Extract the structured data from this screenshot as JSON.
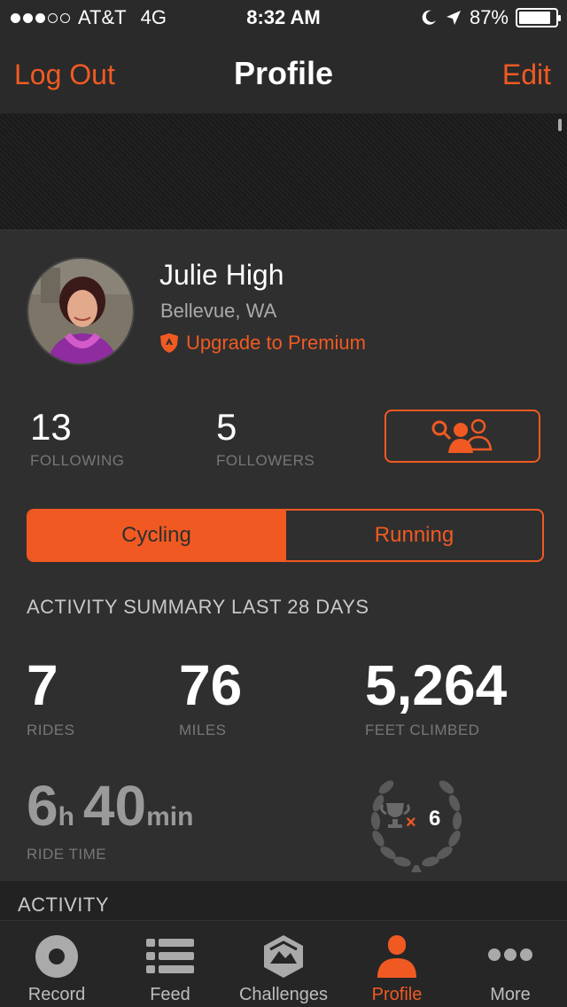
{
  "status_bar": {
    "carrier": "AT&T",
    "network": "4G",
    "time": "8:32 AM",
    "battery": "87%",
    "battery_level": 0.87,
    "signal_bars_filled": 3,
    "signal_bars_total": 5
  },
  "nav": {
    "left": "Log Out",
    "title": "Profile",
    "right": "Edit"
  },
  "profile": {
    "name": "Julie High",
    "location": "Bellevue, WA",
    "premium_label": "Upgrade to Premium"
  },
  "social": {
    "following_count": "13",
    "following_label": "FOLLOWING",
    "followers_count": "5",
    "followers_label": "FOLLOWERS"
  },
  "segment": {
    "active": "Cycling",
    "inactive": "Running"
  },
  "summary": {
    "heading": "ACTIVITY SUMMARY LAST 28 DAYS",
    "rides": "7",
    "rides_label": "RIDES",
    "miles": "76",
    "miles_label": "MILES",
    "feet": "5,264",
    "feet_label": "FEET CLIMBED",
    "ride_hours": "6",
    "hours_unit": "h",
    "ride_minutes": "40",
    "minutes_unit": "min",
    "ride_time_label": "RIDE TIME",
    "trophy_multiplier": "×",
    "trophy_count": "6"
  },
  "activity_heading": "ACTIVITY",
  "tabs": [
    {
      "label": "Record",
      "icon": "record-icon"
    },
    {
      "label": "Feed",
      "icon": "feed-icon"
    },
    {
      "label": "Challenges",
      "icon": "challenges-icon"
    },
    {
      "label": "Profile",
      "icon": "profile-icon"
    },
    {
      "label": "More",
      "icon": "more-icon"
    }
  ],
  "colors": {
    "accent": "#f05a22",
    "background": "#2f2f2f",
    "bar": "#2a2a2a"
  }
}
